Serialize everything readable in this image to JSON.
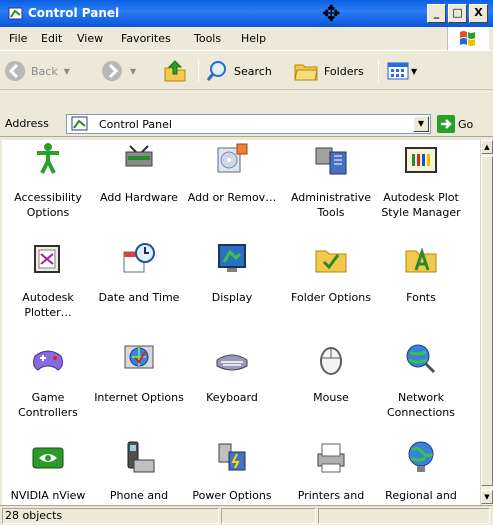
{
  "window": {
    "title": "Control Panel"
  },
  "titlebar_buttons": {
    "minimize": "_",
    "maximize": "□",
    "close": "X"
  },
  "menu": [
    "File",
    "Edit",
    "View",
    "Favorites",
    "Tools",
    "Help"
  ],
  "toolbar": {
    "back_label": "Back",
    "search_label": "Search",
    "folders_label": "Folders"
  },
  "address": {
    "label": "Address",
    "value": "Control Panel",
    "go_label": "Go"
  },
  "items": [
    {
      "label": "Accessibility Options",
      "icon": "accessibility-icon"
    },
    {
      "label": "Add Hardware",
      "icon": "add-hardware-icon"
    },
    {
      "label": "Add or Remov…",
      "icon": "add-remove-programs-icon"
    },
    {
      "label": "Administrative Tools",
      "icon": "administrative-tools-icon"
    },
    {
      "label": "Autodesk Plot Style Manager",
      "icon": "autodesk-plot-style-icon"
    },
    {
      "label": "Autodesk Plotter…",
      "icon": "autodesk-plotter-icon"
    },
    {
      "label": "Date and Time",
      "icon": "date-time-icon"
    },
    {
      "label": "Display",
      "icon": "display-icon"
    },
    {
      "label": "Folder Options",
      "icon": "folder-options-icon"
    },
    {
      "label": "Fonts",
      "icon": "fonts-icon"
    },
    {
      "label": "Game Controllers",
      "icon": "game-controllers-icon"
    },
    {
      "label": "Internet Options",
      "icon": "internet-options-icon"
    },
    {
      "label": "Keyboard",
      "icon": "keyboard-icon"
    },
    {
      "label": "Mouse",
      "icon": "mouse-icon"
    },
    {
      "label": "Network Connections",
      "icon": "network-connections-icon"
    },
    {
      "label": "NVIDIA nView Desktop M…",
      "icon": "nvidia-icon"
    },
    {
      "label": "Phone and Modem …",
      "icon": "phone-modem-icon"
    },
    {
      "label": "Power Options",
      "icon": "power-options-icon"
    },
    {
      "label": "Printers and Faxes",
      "icon": "printers-faxes-icon"
    },
    {
      "label": "Regional and Language …",
      "icon": "regional-language-icon"
    }
  ],
  "status": {
    "objects": "28 objects"
  },
  "colors": {
    "titlebar": "#0a5fe0",
    "chrome": "#ece9d8",
    "content": "#ffffff"
  }
}
